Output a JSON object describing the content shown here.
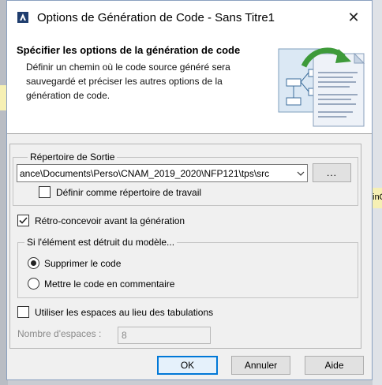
{
  "window": {
    "title": "Options de Génération de Code - Sans Titre1",
    "close_symbol": "✕",
    "app_icon": "app-logo-icon"
  },
  "header": {
    "title": "Spécifier les options de la génération de code",
    "description": "Définir un chemin où le code source généré sera sauvegardé et préciser les autres options de la génération de code."
  },
  "output_dir": {
    "legend": "Répertoire de Sortie",
    "path": "ance\\Documents\\Perso\\CNAM_2019_2020\\NFP121\\tps\\src",
    "browse_label": "...",
    "working_dir_label": "Définir comme répertoire de travail",
    "working_dir_checked": false
  },
  "reverse_engineer": {
    "label": "Rétro-concevoir avant la génération",
    "checked": true
  },
  "on_delete": {
    "legend": "Si l'élément est détruit du modèle...",
    "options": [
      {
        "label": "Supprimer le code",
        "selected": true
      },
      {
        "label": "Mettre le code en commentaire",
        "selected": false
      }
    ]
  },
  "spaces": {
    "checkbox_label": "Utiliser les espaces au lieu des tabulations",
    "checked": false,
    "count_label": "Nombre d'espaces :",
    "count_value": "8"
  },
  "buttons": {
    "ok": "OK",
    "cancel": "Annuler",
    "help": "Aide"
  },
  "background": {
    "right_fragment": "inC"
  },
  "colors": {
    "accent": "#0078d7",
    "check": "#222222"
  }
}
